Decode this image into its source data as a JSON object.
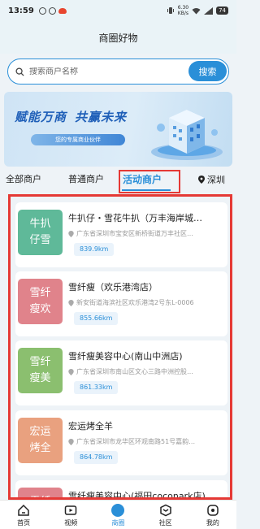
{
  "status_bar": {
    "time": "13:59",
    "network_top": "6.30",
    "network_bottom": "KB/s",
    "battery": "74"
  },
  "header": {
    "title": "商圈好物"
  },
  "search": {
    "placeholder": "搜索商户名称",
    "button_label": "搜索"
  },
  "banner": {
    "slogan_left": "赋能万商",
    "slogan_right": "共赢未来",
    "subtitle": "您的专属商业伙伴"
  },
  "tabs": {
    "all": "全部商户",
    "normal": "普通商户",
    "active": "活动商户",
    "city": "深圳"
  },
  "merchants": [
    {
      "thumb": "牛扒 仔雪",
      "name": "牛扒仔・雪花牛扒（万丰海岸城…",
      "address": "广东省深圳市宝安区新桥街道万丰社区…",
      "distance": "839.9km",
      "color": "#5fb999"
    },
    {
      "thumb": "雪纤 瘦欢",
      "name": "雪纤瘦（欢乐港湾店）",
      "address": "新安街道海滨社区欢乐港湾2号东L-0006",
      "distance": "855.66km",
      "color": "#e0838b"
    },
    {
      "thumb": "雪纤 瘦美",
      "name": "雪纤瘦美容中心(南山中洲店)",
      "address": "广东省深圳市南山区文心三路中洲控股…",
      "distance": "861.33km",
      "color": "#8bbf6f"
    },
    {
      "thumb": "宏运 烤全",
      "name": "宏运烤全羊",
      "address": "广东省深圳市龙华区环观南路51号嘉韵…",
      "distance": "864.78km",
      "color": "#e9a17f"
    },
    {
      "thumb": "雪纤 瘦福",
      "name": "雪纤瘦美容中心(福田coconark店)",
      "address": "",
      "distance": "",
      "color": "#e0838b"
    }
  ],
  "tabbar": [
    {
      "label": "首页",
      "icon": "home-icon"
    },
    {
      "label": "视频",
      "icon": "video-icon"
    },
    {
      "label": "商圈",
      "icon": "shop-circle-icon"
    },
    {
      "label": "社区",
      "icon": "community-icon"
    },
    {
      "label": "我的",
      "icon": "profile-icon"
    }
  ],
  "colors": {
    "accent": "#2a8fd8",
    "highlight_border": "#e53935"
  }
}
